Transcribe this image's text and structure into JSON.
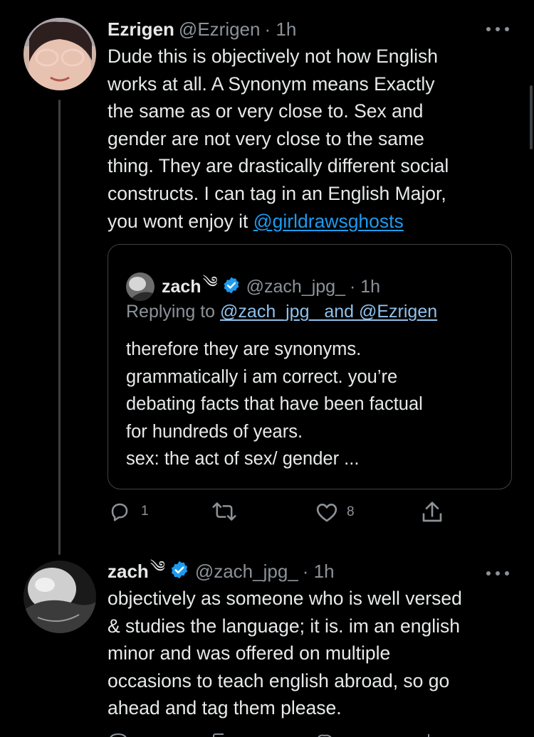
{
  "tweet1": {
    "name": "Ezrigen",
    "handle": "@Ezrigen",
    "time": "· 1h",
    "text": "Dude this is objectively not how English\nworks at all. A Synonym means Exactly\nthe same as or very close to. Sex and\ngender are not very close to the same\nthing. They are drastically different social\nconstructs. I can tag in an English Major,\nyou wont enjoy it ",
    "mention": "@girldrawsghosts",
    "more_icon": "more-horizontal-icon",
    "quote": {
      "name": "zach",
      "emoji": "༄",
      "handle": "@zach_jpg_",
      "time": "· 1h",
      "replying_prefix": "Replying to ",
      "replying_to": "@zach_jpg_ and @Ezrigen",
      "text": "therefore they are synonyms.\ngrammatically i am correct. you’re\ndebating facts that have been factual\nfor hundreds of years.\nsex: the act of sex/ gender ..."
    },
    "actions": {
      "reply_count": "1",
      "retweet_count": "",
      "like_count": "8"
    }
  },
  "tweet2": {
    "name": "zach",
    "emoji": "༄",
    "handle": "@zach_jpg_",
    "time": "· 1h",
    "text": "objectively as someone who is well versed\n& studies the language; it is. im an english\nminor and was offered on multiple\noccasions to teach english abroad,  so go\nahead and tag them please.",
    "more_icon": "more-horizontal-icon"
  },
  "colors": {
    "background": "#000000",
    "text": "#e7e9ea",
    "muted": "#8b9298",
    "accent": "#1d9bf0",
    "border": "#3e4144"
  }
}
